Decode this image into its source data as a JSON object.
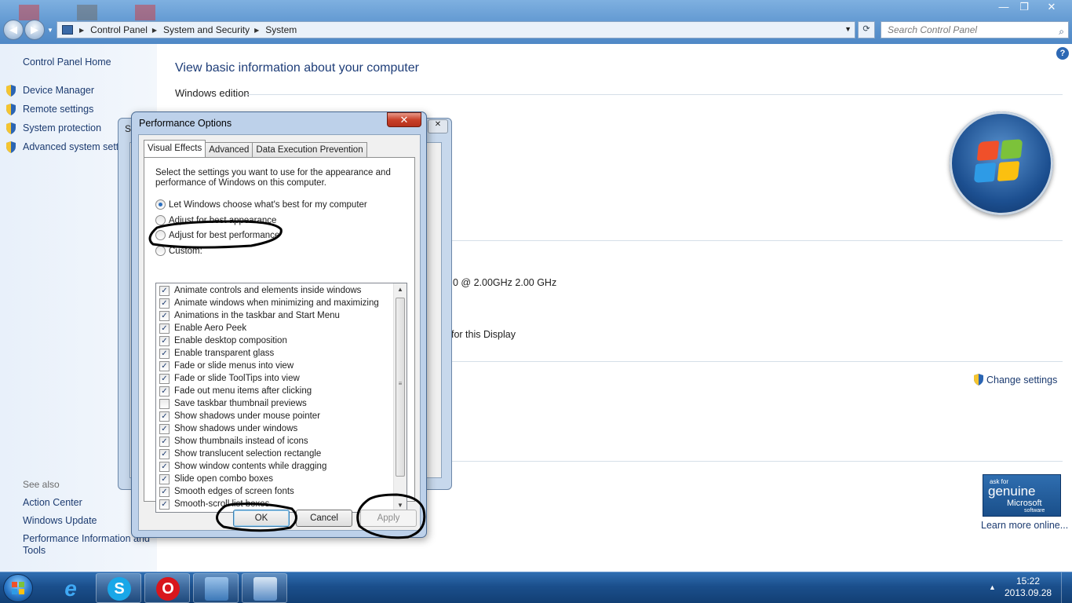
{
  "explorer": {
    "breadcrumb": [
      "Control Panel",
      "System and Security",
      "System"
    ],
    "search_placeholder": "Search Control Panel",
    "window_buttons": {
      "minimize": "—",
      "maximize": "❐",
      "close": "✕"
    }
  },
  "sidebar": {
    "home": "Control Panel Home",
    "items": [
      {
        "label": "Device Manager"
      },
      {
        "label": "Remote settings"
      },
      {
        "label": "System protection"
      },
      {
        "label": "Advanced system setti"
      }
    ],
    "see_also": "See also",
    "see_also_links": [
      {
        "label": "Action Center"
      },
      {
        "label": "Windows Update"
      },
      {
        "label": "Performance Information and"
      },
      {
        "label": "Tools"
      }
    ]
  },
  "main": {
    "title": "View basic information about your computer",
    "windows_edition": "Windows edition",
    "processor_fragment": "0  @ 2.00GHz   2.00 GHz",
    "display_fragment": "for this Display",
    "change_settings": "Change settings",
    "genuine": {
      "small": "ask for",
      "big": "genuine",
      "ms": "Microsoft",
      "sw": "software"
    },
    "learn_more": "Learn more online..."
  },
  "back_window": {
    "title": "Sy"
  },
  "dialog": {
    "title": "Performance Options",
    "close": "✕",
    "tabs": [
      {
        "label": "Visual Effects",
        "active": true
      },
      {
        "label": "Advanced",
        "active": false
      },
      {
        "label": "Data Execution Prevention",
        "active": false
      }
    ],
    "description": "Select the settings you want to use for the appearance and performance of Windows on this computer.",
    "radios": [
      {
        "label": "Let Windows choose what's best for my computer",
        "selected": true
      },
      {
        "label": "Adjust for best appearance",
        "selected": false
      },
      {
        "label": "Adjust for best performance",
        "selected": false
      },
      {
        "label": "Custom:",
        "selected": false
      }
    ],
    "options": [
      {
        "label": "Animate controls and elements inside windows",
        "checked": true
      },
      {
        "label": "Animate windows when minimizing and maximizing",
        "checked": true
      },
      {
        "label": "Animations in the taskbar and Start Menu",
        "checked": true
      },
      {
        "label": "Enable Aero Peek",
        "checked": true
      },
      {
        "label": "Enable desktop composition",
        "checked": true
      },
      {
        "label": "Enable transparent glass",
        "checked": true
      },
      {
        "label": "Fade or slide menus into view",
        "checked": true
      },
      {
        "label": "Fade or slide ToolTips into view",
        "checked": true
      },
      {
        "label": "Fade out menu items after clicking",
        "checked": true
      },
      {
        "label": "Save taskbar thumbnail previews",
        "checked": false
      },
      {
        "label": "Show shadows under mouse pointer",
        "checked": true
      },
      {
        "label": "Show shadows under windows",
        "checked": true
      },
      {
        "label": "Show thumbnails instead of icons",
        "checked": true
      },
      {
        "label": "Show translucent selection rectangle",
        "checked": true
      },
      {
        "label": "Show window contents while dragging",
        "checked": true
      },
      {
        "label": "Slide open combo boxes",
        "checked": true
      },
      {
        "label": "Smooth edges of screen fonts",
        "checked": true
      },
      {
        "label": "Smooth-scroll list boxes",
        "checked": true
      }
    ],
    "buttons": {
      "ok": "OK",
      "cancel": "Cancel",
      "apply": "Apply"
    }
  },
  "taskbar": {
    "apps": [
      {
        "icon": "internet-explorer-icon",
        "glyph": "e"
      },
      {
        "icon": "skype-icon",
        "glyph": "S"
      },
      {
        "icon": "opera-icon",
        "glyph": "O"
      },
      {
        "icon": "control-panel-icon",
        "glyph": ""
      },
      {
        "icon": "system-properties-icon",
        "glyph": ""
      }
    ],
    "time": "15:22",
    "date": "2013.09.28"
  },
  "colors": {
    "link": "#1c3b70",
    "title_blue": "#1e3d78",
    "taskbar": "#1b4f8c",
    "annotation": "#000000"
  }
}
